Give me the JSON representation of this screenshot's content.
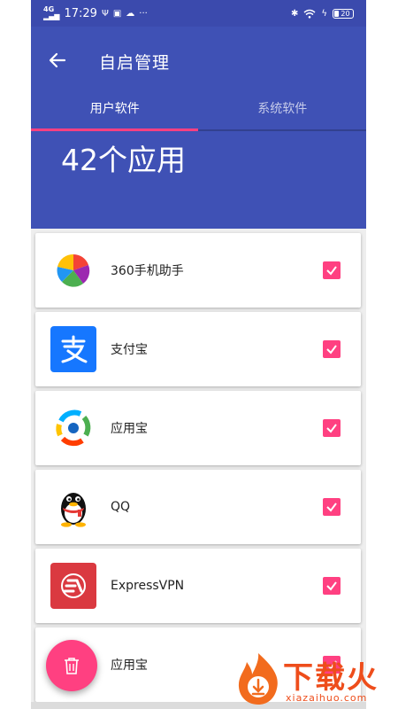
{
  "status_bar": {
    "signal": "4G",
    "time": "17:29",
    "battery": "20"
  },
  "app_bar": {
    "title": "自启管理",
    "tabs": [
      {
        "label": "用户软件",
        "active": true
      },
      {
        "label": "系统软件",
        "active": false
      }
    ],
    "count_label": "42个应用"
  },
  "apps": [
    {
      "name": "360手机助手",
      "icon": "360-assistant-icon",
      "checked": true
    },
    {
      "name": "支付宝",
      "icon": "alipay-icon",
      "checked": true
    },
    {
      "name": "应用宝",
      "icon": "yingyongbao-icon",
      "checked": true
    },
    {
      "name": "QQ",
      "icon": "qq-penguin-icon",
      "checked": true
    },
    {
      "name": "ExpressVPN",
      "icon": "expressvpn-icon",
      "checked": true
    },
    {
      "name": "应用宝",
      "icon": "yingyongbao-icon",
      "checked": true
    }
  ],
  "fab": {
    "icon": "trash-icon"
  },
  "watermark": {
    "title": "下载火",
    "url": "xiazaihuo.com"
  },
  "colors": {
    "primary": "#3f51b5",
    "accent": "#ff4081",
    "background": "#eeeeee"
  }
}
